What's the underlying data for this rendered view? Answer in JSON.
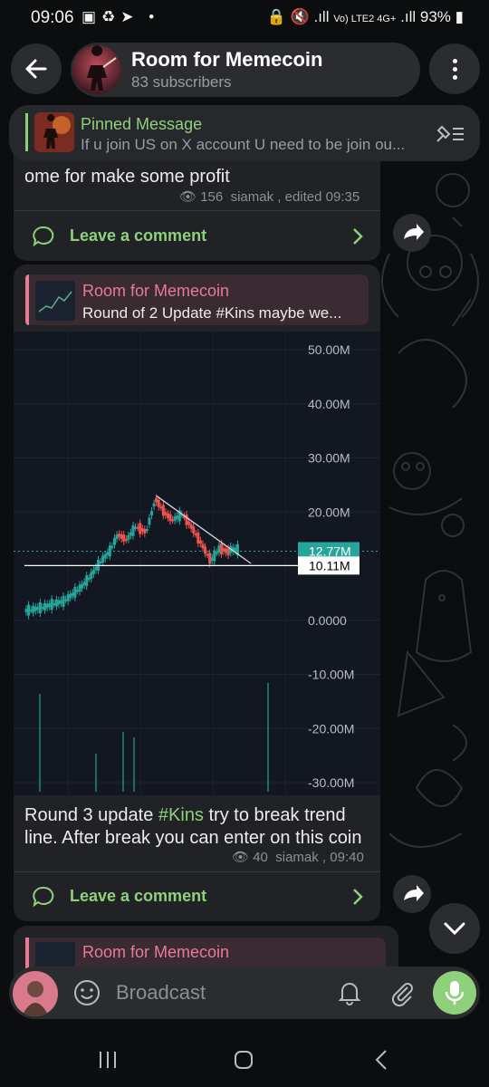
{
  "status_bar": {
    "time": "09:06",
    "battery": "93%",
    "network": "Vo) LTE2 4G+"
  },
  "header": {
    "title": "Room for Memecoin",
    "subtitle": "83 subscribers"
  },
  "pinned": {
    "title": "Pinned Message",
    "text": "If u join US on X account  U need to be join ou..."
  },
  "messages": [
    {
      "text": "ome for make some profit",
      "views": "156",
      "author_time": "siamak , edited 09:35",
      "comment_label": "Leave a comment"
    },
    {
      "reply_name": "Room for Memecoin",
      "reply_text": "Round of 2  Update #Kins maybe we...",
      "text_before": "Round 3 update ",
      "hashtag": "#Kins",
      "text_after": " try to break trend line. After break you can enter on this coin",
      "views": "40",
      "author_time": "siamak , 09:40",
      "comment_label": "Leave a comment"
    },
    {
      "reply_name": "Room for Memecoin"
    }
  ],
  "chart_data": {
    "type": "line",
    "ylim": [
      -30000000,
      50000000
    ],
    "y_ticks": [
      "50.00M",
      "40.00M",
      "30.00M",
      "20.00M",
      "0.0000",
      "-10.00M",
      "-20.00M",
      "-30.00M"
    ],
    "current_price_label": "12.77M",
    "support_level_label": "10.11M",
    "series": [
      {
        "x": [
          0,
          10,
          20,
          30,
          40,
          50,
          60,
          70,
          80,
          90,
          100,
          110,
          120,
          130,
          140,
          150,
          160,
          170,
          180,
          190,
          200,
          210,
          220,
          230
        ],
        "values": [
          1.5,
          1.8,
          2.2,
          2.8,
          3.2,
          4.5,
          6.0,
          8.0,
          10.5,
          12.5,
          16.0,
          15.0,
          17.5,
          16.5,
          22.5,
          20.0,
          18.5,
          19.5,
          17.0,
          14.0,
          11.0,
          13.5,
          12.77,
          12.77
        ]
      }
    ],
    "volume_bars": [
      0.9,
      0.35,
      0.55,
      0.5,
      1.0
    ],
    "colors": {
      "up": "#26a69a",
      "down": "#ef5350",
      "current": "#26a69a",
      "support": "#ffffff",
      "trend": "#d6d6d6"
    }
  },
  "input": {
    "placeholder": "Broadcast"
  },
  "colors": {
    "accent_green": "#8fd07c",
    "reply_pink": "#e87a9a",
    "hashtag": "#8fd07c"
  }
}
